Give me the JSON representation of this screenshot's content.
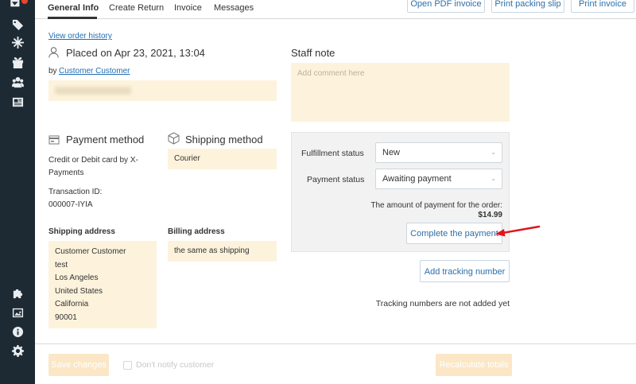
{
  "tabs": {
    "general": "General Info",
    "create_return": "Create Return",
    "invoice": "Invoice",
    "messages": "Messages"
  },
  "header_buttons": {
    "open_pdf": "Open PDF invoice",
    "packing_slip": "Print packing slip",
    "print_invoice": "Print invoice"
  },
  "order": {
    "history_link": "View order history",
    "placed_on": "Placed on Apr 23, 2021, 13:04",
    "by_label": "by",
    "customer_link": "Customer Customer"
  },
  "payment": {
    "title": "Payment method",
    "method": "Credit or Debit card by X-Payments",
    "method_line1": "Credit or Debit card by X-",
    "method_line2": "Payments",
    "txn_label": "Transaction ID:",
    "txn_value": "000007-IYIA"
  },
  "shipping": {
    "title": "Shipping method",
    "method": "Courier"
  },
  "shipping_address": {
    "label": "Shipping address",
    "lines": [
      "Customer Customer",
      "test",
      "Los Angeles",
      "United States",
      "California",
      "90001"
    ]
  },
  "billing_address": {
    "label": "Billing address",
    "value": "the same as shipping"
  },
  "staff_note": {
    "title": "Staff note",
    "placeholder": "Add comment here"
  },
  "status": {
    "fulfillment_label": "Fulfillment status",
    "fulfillment_value": "New",
    "payment_label": "Payment status",
    "payment_value": "Awaiting payment",
    "amount_label": "The amount of payment for the order:",
    "amount_value": "$14.99",
    "complete_button": "Complete the payment"
  },
  "tracking": {
    "add_button": "Add tracking number",
    "empty_text": "Tracking numbers are not added yet"
  },
  "footer": {
    "save": "Save changes",
    "dont_notify": "Don't notify customer",
    "recalculate": "Recalculate totals"
  },
  "colors": {
    "sidebar": "#1e2a33",
    "cream": "#fdf3dc",
    "link": "#1f6db4",
    "arrow": "#e0141e"
  },
  "icons": {
    "sidebar": [
      "tag-icon",
      "snowflake-icon",
      "gift-icon",
      "users-icon",
      "newspaper-icon",
      "puzzle-icon",
      "image-icon",
      "info-icon",
      "gear-icon"
    ]
  }
}
